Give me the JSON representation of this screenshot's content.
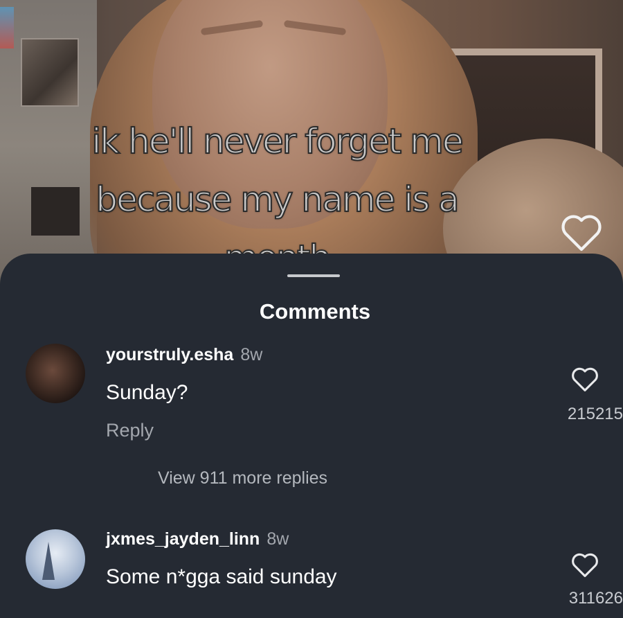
{
  "video": {
    "caption_line1": "ik he'll never forget me",
    "caption_line2": "because my name is a",
    "caption_line3": "month",
    "like_icon": "heart-icon"
  },
  "comments_sheet": {
    "title": "Comments",
    "comments": [
      {
        "username": "yourstruly.esha",
        "time": "8w",
        "text": "Sunday?",
        "reply_label": "Reply",
        "like_count": "215215",
        "view_more": "View 911 more replies",
        "like_icon": "heart-icon"
      },
      {
        "username": "jxmes_jayden_linn",
        "time": "8w",
        "text": "Some n*gga said sunday",
        "like_count": "311626",
        "like_icon": "heart-icon"
      }
    ]
  },
  "colors": {
    "sheet_background": "#252a33",
    "primary_text": "#ffffff",
    "secondary_text": "#a3a7ae"
  }
}
